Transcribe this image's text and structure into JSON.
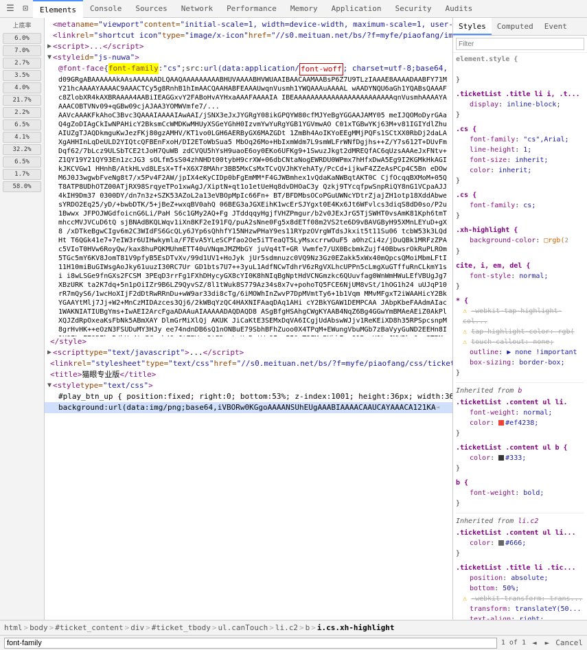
{
  "toolbar": {
    "tabs": [
      {
        "label": "Elements",
        "active": true
      },
      {
        "label": "Console",
        "active": false
      },
      {
        "label": "Sources",
        "active": false
      },
      {
        "label": "Network",
        "active": false
      },
      {
        "label": "Performance",
        "active": false
      },
      {
        "label": "Memory",
        "active": false
      },
      {
        "label": "Application",
        "active": false
      },
      {
        "label": "Security",
        "active": false
      },
      {
        "label": "Audits",
        "active": false
      }
    ]
  },
  "styles_tabs": [
    {
      "label": "Styles",
      "active": true
    },
    {
      "label": "Computed",
      "active": false
    },
    {
      "label": "Event List",
      "active": false
    }
  ],
  "filter": {
    "placeholder": "Filter"
  },
  "breadcrumb": {
    "items": [
      "html",
      "body",
      "#ticket_content",
      "div",
      "#ticket_tbody",
      "ul.canTouch",
      "li.c2",
      "b",
      "i.cs.xh-highlight"
    ]
  },
  "search": {
    "value": "font-family",
    "result": "1 of 1",
    "prev_label": "◄",
    "next_label": "►",
    "cancel_label": "Cancel"
  },
  "gutter": {
    "top_label": "上底率",
    "items": [
      "6.0%",
      "7.0%",
      "2.7%",
      "3.5%",
      "4.0%",
      "21.7%",
      "2.2%",
      "6.5%",
      "4.1%",
      "32.2%",
      "6.5%",
      "1.7%",
      "58.0%"
    ]
  }
}
